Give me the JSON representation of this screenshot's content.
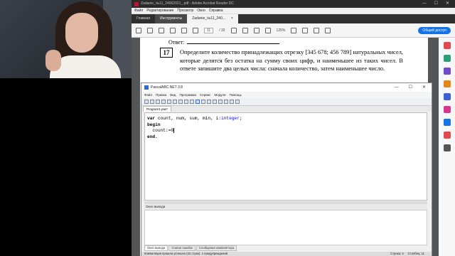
{
  "acrobat": {
    "title": "Zadanie_№11_24062021_.pdf - Adobe Acrobat Reader DC",
    "window_controls": [
      "—",
      "☐",
      "✕"
    ],
    "menu": [
      "Файл",
      "Редактирование",
      "Просмотр",
      "Окно",
      "Справка"
    ],
    "tabs": [
      "Главная",
      "Инструменты"
    ],
    "doc_tab": "Zadanie_№11_240...",
    "doc_tab_close": "×",
    "page_current": "11",
    "page_total": "/ 32",
    "zoom": "125%",
    "share_label": "Общий доступ"
  },
  "document": {
    "answer_label": "Ответ:",
    "task_number": "17",
    "task_text": "Определите количество принадлежащих отрезку [345 678; 456 789] натуральных чисел, которые делятся без остатка на сумму своих цифр, и наименьшее из таких чисел. В ответе запишите два целых числа: сначала количество, затем наименьшее число."
  },
  "pascal": {
    "title": "PascalABC.NET 3.8",
    "window_controls": [
      "—",
      "☐",
      "✕"
    ],
    "menu": [
      "Файл",
      "Правка",
      "Вид",
      "Программа",
      "Сервис",
      "Модули",
      "Помощь"
    ],
    "editor_tab": "Program1.pas*",
    "code": {
      "line1_kw": "var",
      "line1_rest": " count, num, sum, min, i:",
      "line1_type": "integer",
      "line1_end": ";",
      "line2": "begin",
      "line3": "  count:=0",
      "line4": "end."
    },
    "output_header": "Окно вывода",
    "bottom_tabs": [
      "Окно вывода",
      "Список ошибок",
      "Сообщения компилятора"
    ],
    "status_left": "Компиляция прошла успешно (22 строк). 1 предупреждений",
    "status_line": "Строка: 4",
    "status_col": "Столбец: 11"
  },
  "colors": {
    "acrobat_share": "#1473e6",
    "pascal_keyword": "#000000",
    "pascal_type": "#0000ff"
  },
  "side_icons": [
    "#e34850",
    "#2d9d78",
    "#6e49cb",
    "#e68619",
    "#3a5fd6",
    "#d83790",
    "#1473e6",
    "#e34850",
    "#555555"
  ]
}
